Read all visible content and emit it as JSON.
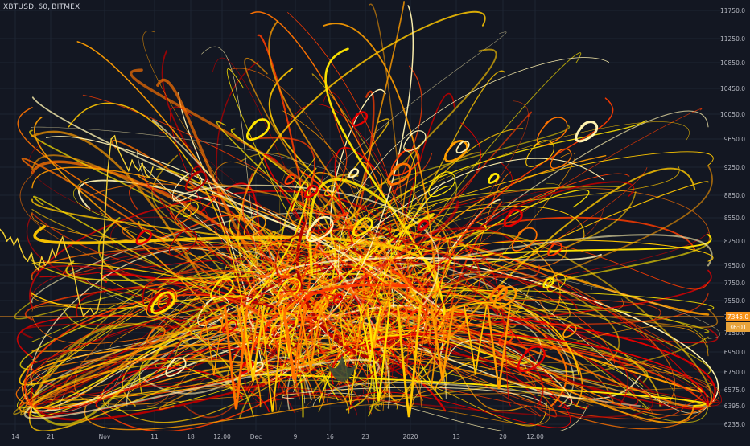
{
  "header": {
    "symbol": "XBTUSD",
    "interval": "60",
    "exchange": "BITMEX",
    "separator": ", "
  },
  "colors": {
    "background": "#131722",
    "grid": "#1e2433",
    "axis_text": "#b2b5be",
    "price_line": "#f7931a",
    "badge_primary": "#f7931a",
    "badge_secondary": "#e8a33a",
    "candle": "#f5d130",
    "flame_palette": [
      "#ffe600",
      "#ffc800",
      "#ff9d00",
      "#ff7300",
      "#ff3c00",
      "#e60000",
      "#b30000",
      "#fff3b0"
    ]
  },
  "chart_data": {
    "type": "line",
    "title": "",
    "xlabel": "",
    "ylabel": "",
    "ylim": [
      6235,
      11900
    ],
    "x_tick_labels": [
      "14",
      "21",
      "Nov",
      "11",
      "18",
      "12:00",
      "Dec",
      "9",
      "16",
      "23",
      "2020",
      "13",
      "20",
      "12:00"
    ],
    "y_tick_labels": [
      "11750.0",
      "11250.0",
      "10850.0",
      "10450.0",
      "10050.0",
      "9650.0",
      "9250.0",
      "8850.0",
      "8550.0",
      "8250.0",
      "7950.0",
      "7750.0",
      "7550.0",
      "7345.0",
      "7150.0",
      "6950.0",
      "6750.0",
      "6575.0",
      "6395.0",
      "6235.0"
    ],
    "y_tick_values": [
      11750,
      11250,
      10850,
      10450,
      10050,
      9650,
      9250,
      8850,
      8550,
      8250,
      7950,
      7750,
      7550,
      7345,
      7150,
      6950,
      6750,
      6575,
      6395,
      6235
    ],
    "current_price": {
      "label": "7345.0",
      "value": 7345.0
    },
    "secondary_badge": {
      "label": "36:01"
    },
    "series": [
      {
        "values": [
          8400,
          8350,
          8250,
          8300,
          8200,
          8280,
          8150,
          8050,
          8000,
          8100,
          7950,
          7900,
          8050,
          7950,
          8000,
          8150,
          8050,
          8200,
          8300,
          8150,
          8050,
          7900,
          7700,
          7500,
          7350,
          7400,
          7450,
          7380,
          7420,
          7600,
          8400,
          9200,
          9650,
          9700,
          9500,
          9400,
          9300,
          9200,
          9350,
          9250,
          9200,
          9300,
          9150,
          9100,
          9250
        ]
      }
    ]
  }
}
